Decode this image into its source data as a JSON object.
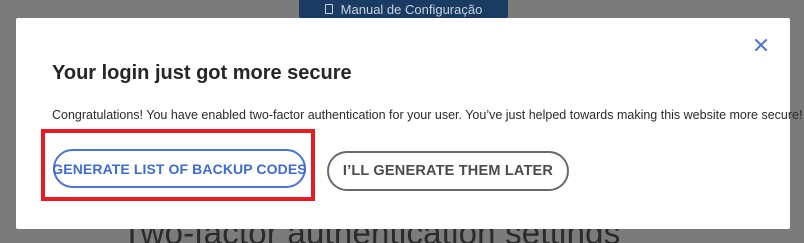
{
  "background": {
    "top_button_label": "Manual de Configuração",
    "page_heading": "Two-factor authentication settings"
  },
  "modal": {
    "title": "Your login just got more secure",
    "message": "Congratulations! You have enabled two-factor authentication for your user. You’ve just helped towards making this website more secure!",
    "primary_button_label": "GENERATE LIST OF BACKUP CODES",
    "secondary_button_label": "I’LL GENERATE THEM LATER",
    "close_icon": "close-icon"
  },
  "colors": {
    "accent": "#3f6ad4",
    "highlight": "#e51c23",
    "backdrop": "#7b7b7b",
    "top_button": "#1a3b62"
  }
}
